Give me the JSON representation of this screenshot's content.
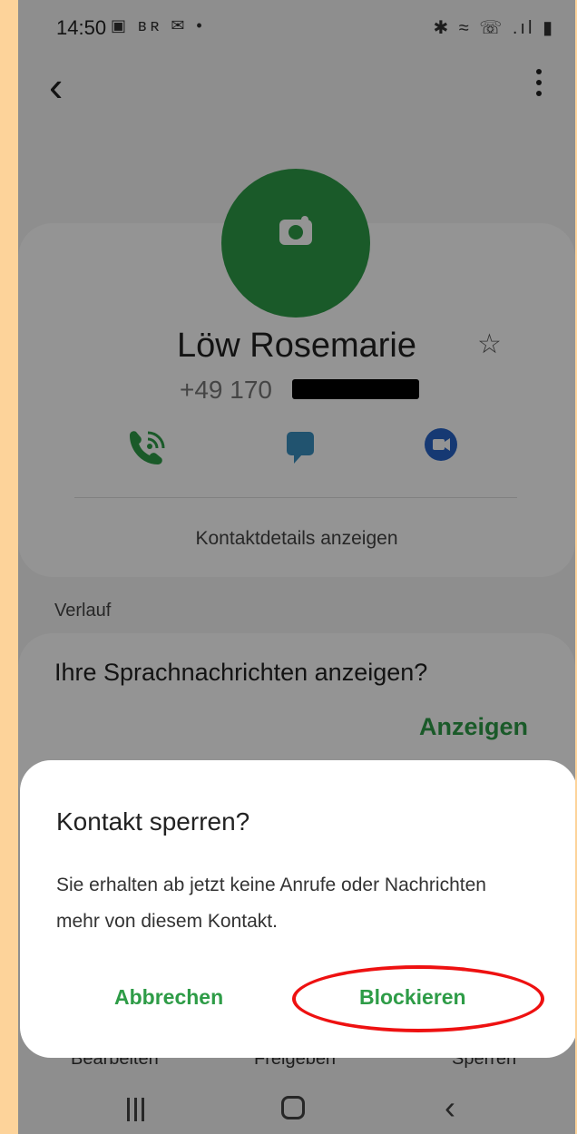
{
  "status_bar": {
    "time": "14:50",
    "left_icons": [
      "gallery-icon",
      "br-icon",
      "mail-icon",
      "dot-icon"
    ],
    "left_icons_text": "▣ ʙʀ ✉ •",
    "right_icons": [
      "bluetooth-icon",
      "wifi-icon",
      "wifi-call-icon",
      "signal-icon",
      "battery-icon"
    ],
    "right_icons_text": "✱ ≈ ☏ .ıl ▮"
  },
  "contact": {
    "name": "Löw Rosemarie",
    "phone_prefix": "+49 170",
    "details_link": "Kontaktdetails anzeigen"
  },
  "history": {
    "heading": "Verlauf",
    "voicemail_question": "Ihre Sprachnachrichten anzeigen?",
    "show_button": "Anzeigen"
  },
  "bottom_bar": {
    "items": [
      "Bearbeiten",
      "Freigeben",
      "Sperren"
    ]
  },
  "dialog": {
    "title": "Kontakt sperren?",
    "message": "Sie erhalten ab jetzt keine Anrufe oder Nachrichten mehr von diesem Kontakt.",
    "cancel_label": "Abbrechen",
    "block_label": "Blockieren"
  },
  "colors": {
    "accent": "#2e9c47",
    "highlight": "#ee1111",
    "page_border": "#fdd39a"
  }
}
